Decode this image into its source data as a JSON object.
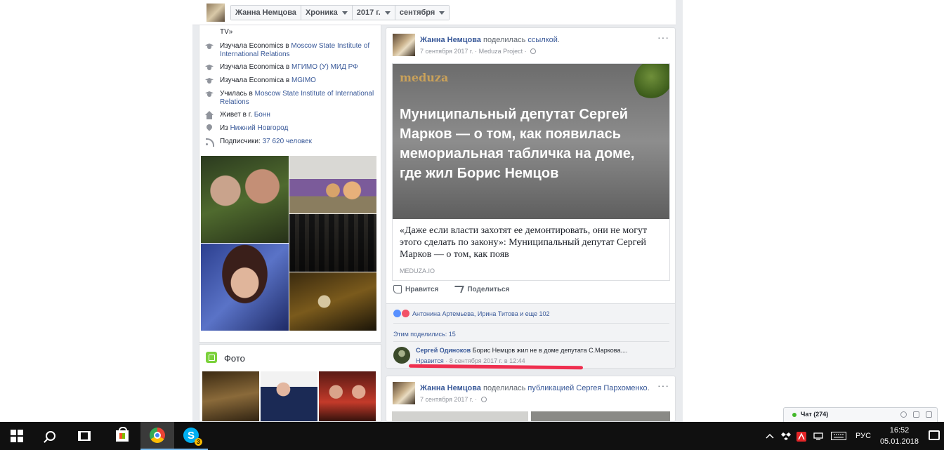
{
  "timeline_bar": {
    "crumbs": [
      "Жанна Немцова",
      "Хроника",
      "2017 г.",
      "сентября"
    ]
  },
  "intro": {
    "cut_top_line": "TV»",
    "items": [
      {
        "icon": "graduation-cap-icon",
        "prefix": "Изучала Economics в ",
        "link": "Moscow State Institute of International Relations"
      },
      {
        "icon": "graduation-cap-icon",
        "prefix": "Изучала Economica в ",
        "link": "МГИМО (У) МИД РФ"
      },
      {
        "icon": "graduation-cap-icon",
        "prefix": "Изучала Economica в ",
        "link": "MGIMO"
      },
      {
        "icon": "graduation-cap-icon",
        "prefix": "Училась в ",
        "link": "Moscow State Institute of International Relations"
      },
      {
        "icon": "home-icon",
        "prefix": "Живет в г. ",
        "link": "Бонн"
      },
      {
        "icon": "location-pin-icon",
        "prefix": "Из ",
        "link": "Нижний Новгород"
      },
      {
        "icon": "followers-icon",
        "prefix": "Подписчики: ",
        "link": "37 620 человек"
      }
    ]
  },
  "photos_section": {
    "title": "Фото"
  },
  "post1": {
    "author": "Жанна Немцова",
    "action_text": " поделилась ",
    "action_link": "ссылкой",
    "date": "7 сентября 2017 г.",
    "source": "Meduza Project",
    "link_logo": "meduza",
    "link_headline": "Муниципальный депутат Сергей Марков — о том, как появилась мемориальная табличка на доме, где жил Борис Немцов",
    "link_description": "«Даже если власти захотят ее демонтировать, они не могут этого сделать по закону»: Муниципальный депутат Сергей Марков — о том, как появ",
    "link_domain": "MEDUZA.IO",
    "like_label": "Нравится",
    "share_label": "Поделиться",
    "reactions_text": "Антонина Артемьева, Ирина Титова и еще 102",
    "shares_text": "Этим поделились: 15",
    "comment": {
      "author": "Сергей Одиноков",
      "text": "Борис Немцов жил не в доме депутата С.Маркова....",
      "like_label": "Нравится",
      "time": "8 сентября 2017 г. в 12:44"
    }
  },
  "post2": {
    "author": "Жанна Немцова",
    "action_text": " поделилась ",
    "action_link": "публикацией Сергея Пархоменко",
    "date": "7 сентября 2017 г."
  },
  "chat": {
    "label": "Чат (274)"
  },
  "taskbar": {
    "language": "РУС",
    "time": "16:52",
    "date": "05.01.2018",
    "skype_badge": "3"
  }
}
